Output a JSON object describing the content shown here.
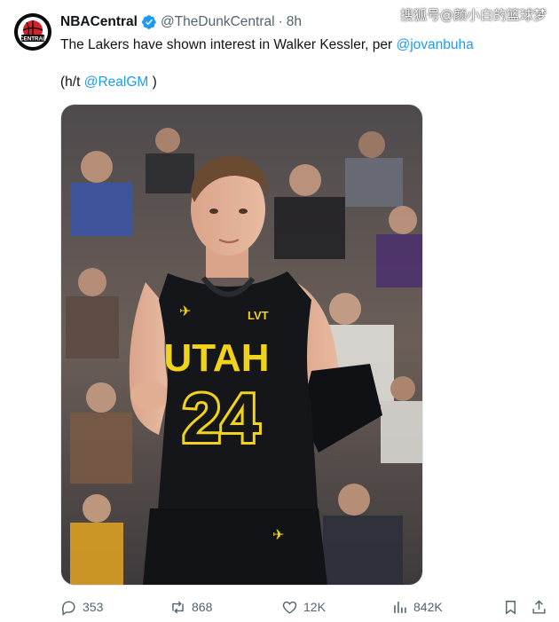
{
  "watermark": "搜狐号@颜小白的篮球梦",
  "author": {
    "name": "NBACentral",
    "handle": "@TheDunkCentral",
    "separator": "·",
    "time": "8h",
    "avatar_text": "CENTRAL",
    "verified_color": "#1d9bf0"
  },
  "tweet": {
    "text_before": "The Lakers have shown interest in Walker Kessler, per ",
    "mention_1": "@jovanbuha",
    "hat_tip_prefix": "(h/t ",
    "mention_2": "@RealGM",
    "hat_tip_suffix": " )"
  },
  "media": {
    "jersey_team": "UTAH",
    "jersey_number": "24",
    "jersey_logo": "LVT",
    "jersey_color": "#15161a",
    "lettering_color": "#f2d31b"
  },
  "actions": {
    "replies": "353",
    "reposts": "868",
    "likes": "12K",
    "views": "842K"
  },
  "colors": {
    "accent": "#1d9bf0",
    "muted": "#536471"
  }
}
